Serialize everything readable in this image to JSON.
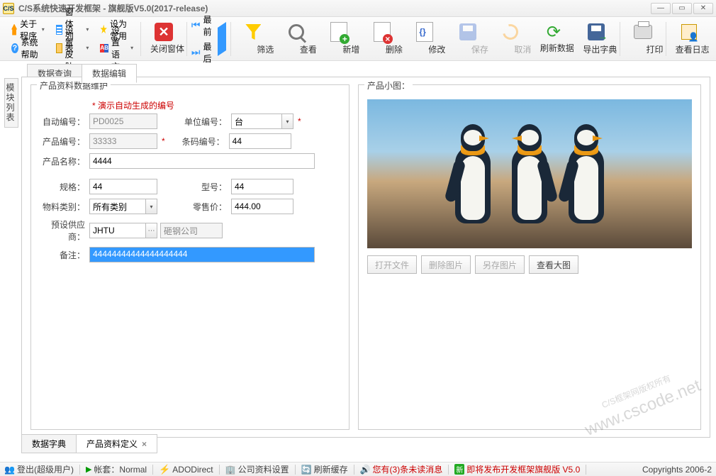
{
  "titlebar": {
    "appIconText": "C/S",
    "title": "C/S系统快速开发框架 - 旗舰版V5.0(2017-release)"
  },
  "toolbar": {
    "about": "关于程序",
    "help": "系统帮助",
    "winList": "窗体列表",
    "skin": "设置皮肤",
    "fav": "设为常用",
    "lang": "设置语言",
    "closeWin": "关闭窗体",
    "first": "最前",
    "last": "最后",
    "filter": "筛选",
    "view": "查看",
    "add": "新增",
    "del": "删除",
    "edit": "修改",
    "save": "保存",
    "cancel": "取消",
    "refresh": "刷新数据",
    "export": "导出字典",
    "print": "打印",
    "log": "查看日志"
  },
  "sideTab": "模块列表",
  "tabsTop": {
    "query": "数据查询",
    "edit": "数据编辑"
  },
  "form": {
    "legend": "产品资料数据维护",
    "demoNote": "* 演示自动生成的编号",
    "labels": {
      "autoNo": "自动编号：",
      "unitNo": "单位编号：",
      "prodNo": "产品编号：",
      "barcode": "条码编号：",
      "prodName": "产品名称：",
      "spec": "规格：",
      "model": "型号：",
      "matCat": "物料类别：",
      "retail": "零售价：",
      "supplier": "预设供应商：",
      "remark": "备注："
    },
    "values": {
      "autoNo": "PD0025",
      "unitNo": "台",
      "prodNo": "33333",
      "barcode": "44",
      "prodName": "4444",
      "spec": "44",
      "model": "44",
      "matCat": "所有类别",
      "retail": "444.00",
      "supplierCode": "JHTU",
      "supplierName": "砸钢公司",
      "remark": "44444444444444444444"
    }
  },
  "image": {
    "legend": "产品小图：",
    "btns": {
      "open": "打开文件",
      "del": "删除图片",
      "saveAs": "另存图片",
      "viewBig": "查看大图"
    }
  },
  "tabsBottom": {
    "dict": "数据字典",
    "prodDef": "产品资料定义"
  },
  "status": {
    "login": "登出(超级用户)",
    "account": "帐套：Normal",
    "ado": "ADODirect",
    "company": "公司资料设置",
    "refreshCache": "刷新缓存",
    "msgPrefix": "您有(",
    "msgCount": "3",
    "msgSuffix": ")条未读消息",
    "newBadge": "新",
    "release": "即将发布开发框架旗舰版 V5.0",
    "copyright": "Copyrights 2006-2"
  },
  "watermark": {
    "line1": "C/S框架网版权所有",
    "line2": "www.cscode.net"
  }
}
